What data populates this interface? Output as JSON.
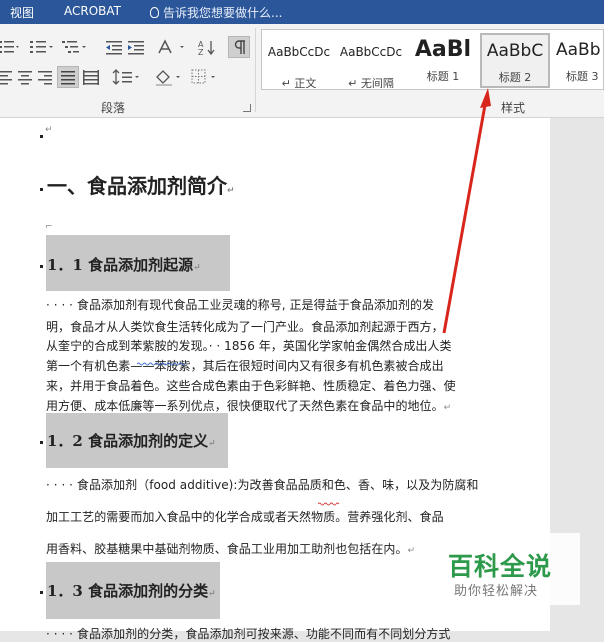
{
  "menu": {
    "view": "视图",
    "acrobat": "ACROBAT",
    "tell_me": "告诉我您想要做什么..."
  },
  "ribbon": {
    "paragraph_group": "段落",
    "styles_group": "样式",
    "styles": [
      {
        "sample": "AaBbCcDc",
        "name": "↵ 正文"
      },
      {
        "sample": "AaBbCcDc",
        "name": "↵ 无间隔"
      },
      {
        "sample": "AaBl",
        "name": "标题 1"
      },
      {
        "sample": "AaBbC",
        "name": "标题 2"
      },
      {
        "sample": "AaBb",
        "name": "标题 3"
      }
    ]
  },
  "document": {
    "heading1": "一、食品添加剂简介",
    "sections": [
      {
        "heading": "1．1 食品添加剂起源",
        "lines": [
          "· · · · 食品添加剂有现代食品工业灵魂的称号, 正是得益于食品添加剂的发",
          "明，食品才从人类饮食生活转化成为了一门产业。食品添加剂起源于西方，",
          "从奎宁的合成到苯紫胺的发现。· · 1856 年，英国化学家帕金偶然合成出人类",
          "第一个有机色素——苯胺紫，其后在很短时间内又有很多有机色素被合成出",
          "来，并用于食品着色。这些合成色素由于色彩鲜艳、性质稳定、着色力强、使",
          "用方便、成本低廉等一系列优点，很快便取代了天然色素在食品中的地位。"
        ]
      },
      {
        "heading": "1．2 食品添加剂的定义",
        "lines": [
          "· · · · 食品添加剂（food additive):为改善食品品质和色、香、味，以及为防腐和",
          "加工工艺的需要而加入食品中的化学合成或者天然物质。营养强化剂、食品",
          "用香料、胶基糖果中基础剂物质、食品工业用加工助剂也包括在内。"
        ]
      },
      {
        "heading": "1．3 食品添加剂的分类",
        "lines": [
          "· · · · 食品添加剂的分类，食品添加剂可按来源、功能不同而有不同划分方式"
        ]
      }
    ]
  },
  "watermark": {
    "title": "百科全说",
    "subtitle": "助你轻松解决"
  },
  "colors": {
    "title_bar": "#2b579a",
    "heading_highlight": "#c8c8c8",
    "arrow": "#d9261c",
    "watermark_green": "#2c9a4a"
  }
}
